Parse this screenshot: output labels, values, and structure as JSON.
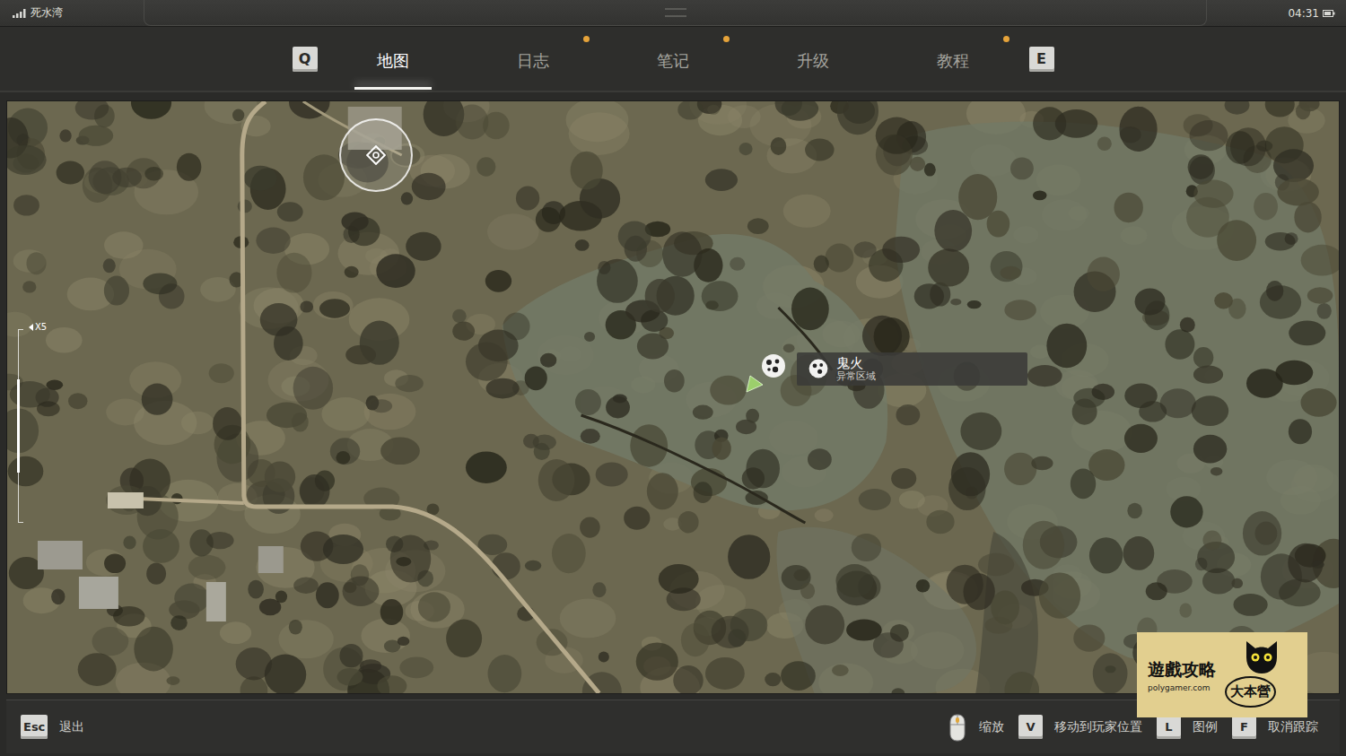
{
  "status_bar": {
    "location": "死水湾",
    "time": "04:31"
  },
  "tabs": {
    "prev_key": "Q",
    "next_key": "E",
    "items": [
      {
        "label": "地图",
        "selected": true,
        "notification": false
      },
      {
        "label": "日志",
        "selected": false,
        "notification": true
      },
      {
        "label": "笔记",
        "selected": false,
        "notification": true
      },
      {
        "label": "升级",
        "selected": false,
        "notification": false
      },
      {
        "label": "教程",
        "selected": false,
        "notification": true
      }
    ]
  },
  "map": {
    "zoom": {
      "label": "X5",
      "level": 0.5
    },
    "markers": [
      {
        "kind": "waypoint"
      },
      {
        "kind": "anomaly"
      },
      {
        "kind": "player"
      }
    ],
    "tooltip": {
      "title": "鬼火",
      "subtitle": "异常区域"
    }
  },
  "hints": {
    "left": [
      {
        "kind": "key",
        "key": "Esc",
        "label": "退出"
      }
    ],
    "right": [
      {
        "kind": "mouse",
        "key": "",
        "label": "缩放"
      },
      {
        "kind": "key",
        "key": "V",
        "label": "移动到玩家位置"
      },
      {
        "kind": "key",
        "key": "L",
        "label": "图例"
      },
      {
        "kind": "key",
        "key": "F",
        "label": "取消跟踪"
      }
    ]
  },
  "watermark": {
    "title": "遊戲攻略",
    "url": "polygamer.com",
    "name": "大本營"
  }
}
